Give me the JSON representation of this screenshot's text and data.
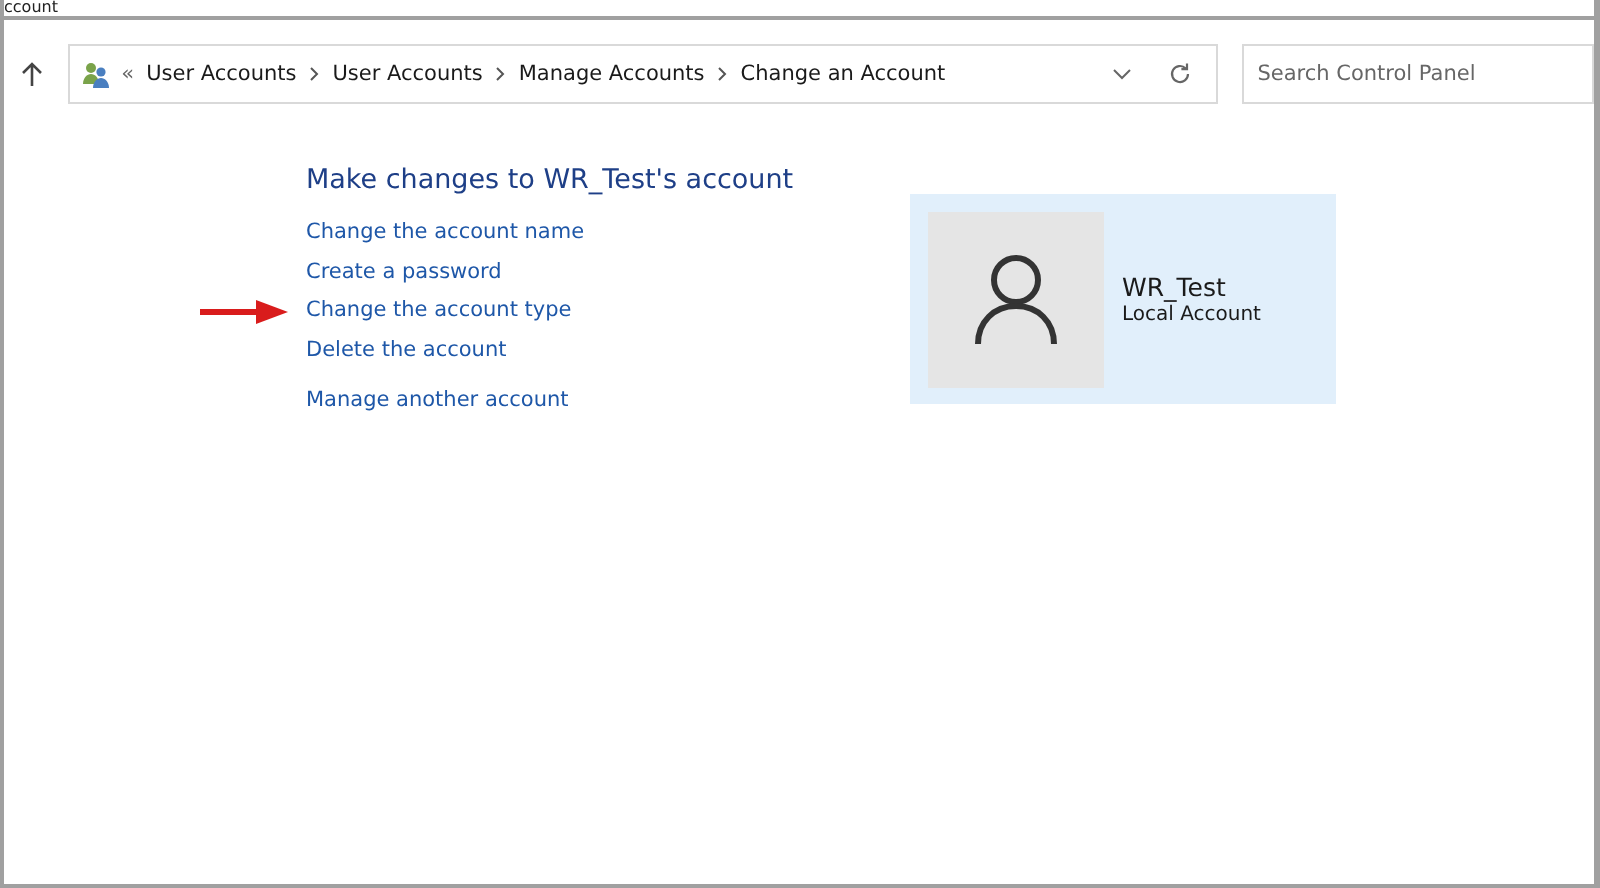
{
  "window": {
    "title": "ccount"
  },
  "address_bar": {
    "overflow": "«",
    "crumbs": [
      "User Accounts",
      "User Accounts",
      "Manage Accounts",
      "Change an Account"
    ]
  },
  "search": {
    "placeholder": "Search Control Panel"
  },
  "heading": "Make changes to WR_Test's account",
  "links": [
    {
      "label": "Change the account name",
      "highlighted": false
    },
    {
      "label": "Create a password",
      "highlighted": false
    },
    {
      "label": "Change the account type",
      "highlighted": true
    },
    {
      "label": "Delete the account",
      "highlighted": false
    }
  ],
  "other_link": "Manage another account",
  "account": {
    "name": "WR_Test",
    "type": "Local Account"
  }
}
